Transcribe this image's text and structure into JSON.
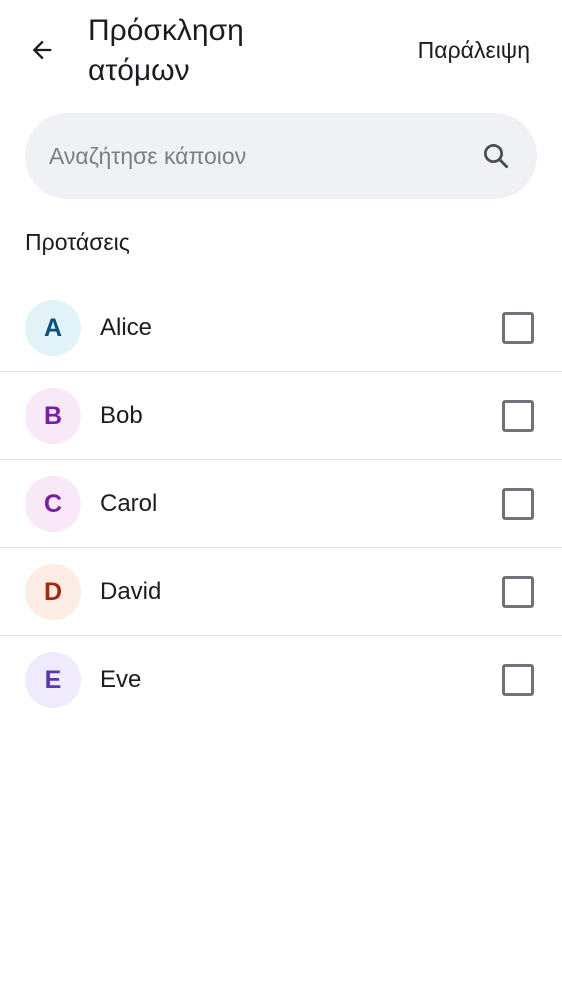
{
  "header": {
    "title": "Πρόσκληση ατόμων",
    "skip_label": "Παράλειψη"
  },
  "search": {
    "placeholder": "Αναζήτησε κάποιον",
    "value": ""
  },
  "suggestions": {
    "title": "Προτάσεις",
    "people": [
      {
        "initial": "A",
        "name": "Alice",
        "checked": false,
        "avatar_bg": "#e1f3f8",
        "avatar_fg": "#0b4f7a"
      },
      {
        "initial": "B",
        "name": "Bob",
        "checked": false,
        "avatar_bg": "#f9e8f7",
        "avatar_fg": "#7b1fa2"
      },
      {
        "initial": "C",
        "name": "Carol",
        "checked": false,
        "avatar_bg": "#f9e8f7",
        "avatar_fg": "#7b1fa2"
      },
      {
        "initial": "D",
        "name": "David",
        "checked": false,
        "avatar_bg": "#fdece3",
        "avatar_fg": "#a0290f"
      },
      {
        "initial": "E",
        "name": "Eve",
        "checked": false,
        "avatar_bg": "#efebfc",
        "avatar_fg": "#5e35b1"
      }
    ]
  },
  "icons": {
    "back": "arrow-left-icon",
    "search": "search-icon"
  }
}
